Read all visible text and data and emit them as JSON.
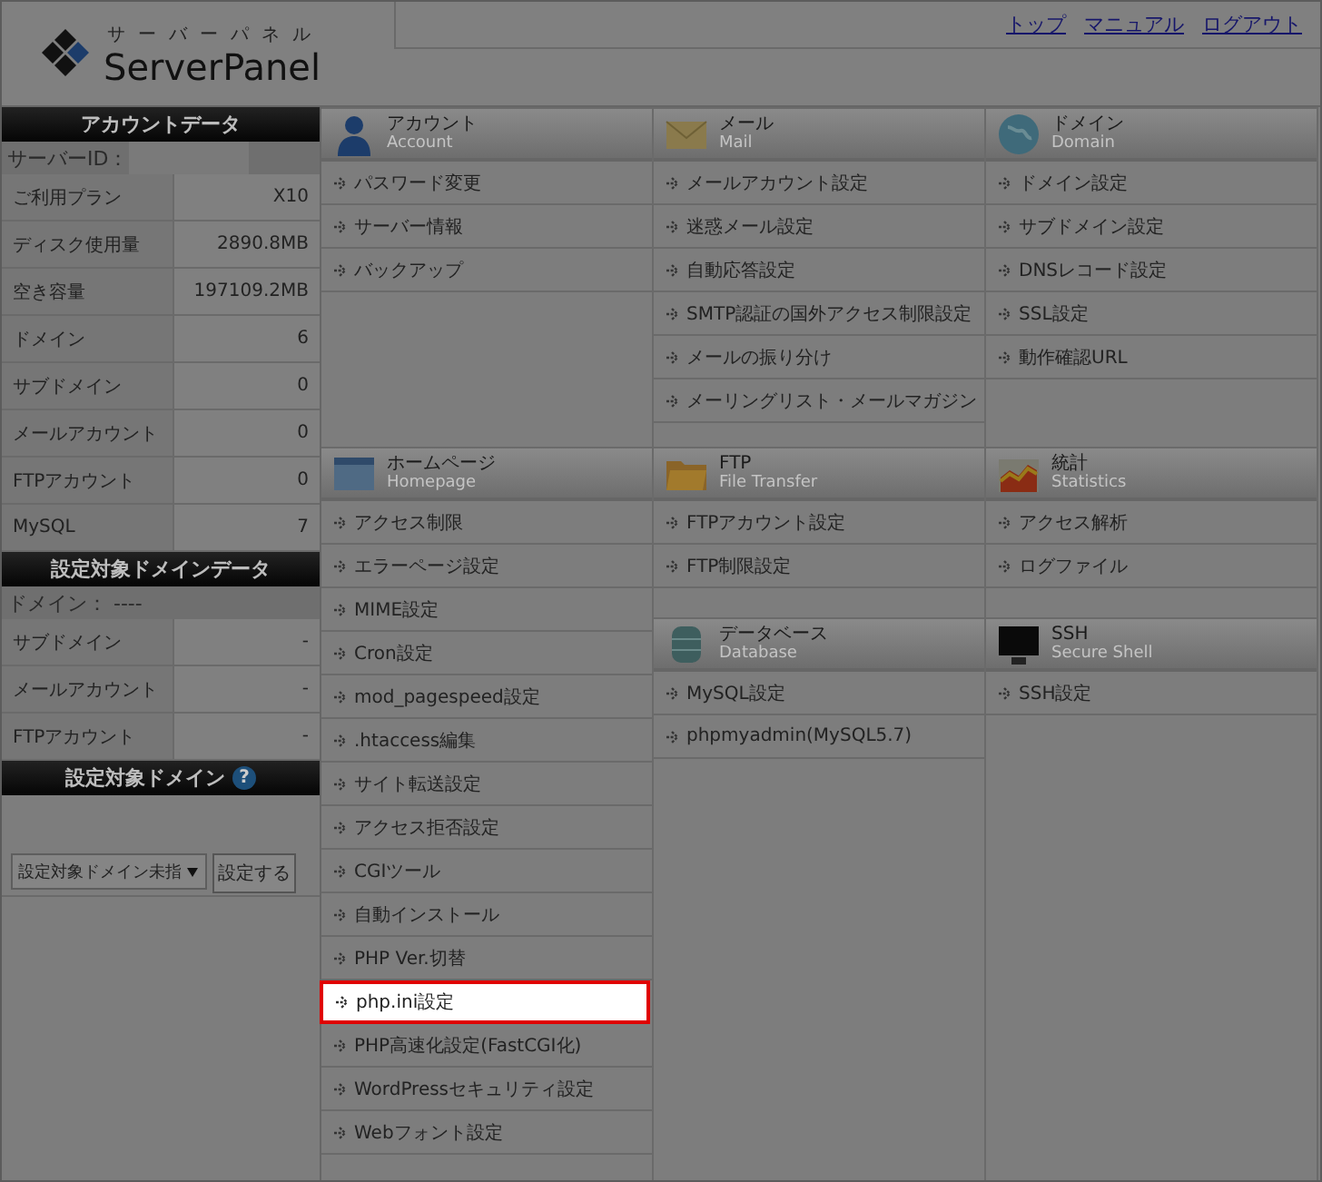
{
  "header": {
    "logo_kana": "サーバーパネル",
    "logo_text": "ServerPanel",
    "links": [
      "トップ",
      "マニュアル",
      "ログアウト"
    ]
  },
  "sidebar": {
    "account_title": "アカウントデータ",
    "server_id_label": "サーバーID：",
    "account_rows": [
      {
        "label": "ご利用プラン",
        "value": "X10"
      },
      {
        "label": "ディスク使用量",
        "value": "2890.8MB"
      },
      {
        "label": "空き容量",
        "value": "197109.2MB"
      },
      {
        "label": "ドメイン",
        "value": "6"
      },
      {
        "label": "サブドメイン",
        "value": "0"
      },
      {
        "label": "メールアカウント",
        "value": "0"
      },
      {
        "label": "FTPアカウント",
        "value": "0"
      },
      {
        "label": "MySQL",
        "value": "7"
      }
    ],
    "domain_data_title": "設定対象ドメインデータ",
    "domain_label": "ドメイン： ----",
    "domain_rows": [
      {
        "label": "サブドメイン",
        "value": "-"
      },
      {
        "label": "メールアカウント",
        "value": "-"
      },
      {
        "label": "FTPアカウント",
        "value": "-"
      }
    ],
    "domain_select_title": "設定対象ドメイン",
    "help_mark": "?",
    "select_value": "設定対象ドメイン未指",
    "set_button": "設定する"
  },
  "sections": [
    {
      "kind": "account",
      "title": "アカウント",
      "subtitle": "Account",
      "items": [
        {
          "label": "パスワード変更",
          "highlighted": false
        },
        {
          "label": "サーバー情報",
          "highlighted": false
        },
        {
          "label": "バックアップ",
          "highlighted": false
        }
      ]
    },
    {
      "kind": "mail",
      "title": "メール",
      "subtitle": "Mail",
      "items": [
        {
          "label": "メールアカウント設定",
          "highlighted": false
        },
        {
          "label": "迷惑メール設定",
          "highlighted": false
        },
        {
          "label": "自動応答設定",
          "highlighted": false
        },
        {
          "label": "SMTP認証の国外アクセス制限設定",
          "highlighted": false
        },
        {
          "label": "メールの振り分け",
          "highlighted": false
        },
        {
          "label": "メーリングリスト・メールマガジン",
          "highlighted": false
        }
      ]
    },
    {
      "kind": "domain",
      "title": "ドメイン",
      "subtitle": "Domain",
      "items": [
        {
          "label": "ドメイン設定",
          "highlighted": false
        },
        {
          "label": "サブドメイン設定",
          "highlighted": false
        },
        {
          "label": "DNSレコード設定",
          "highlighted": false
        },
        {
          "label": "SSL設定",
          "highlighted": false
        },
        {
          "label": "動作確認URL",
          "highlighted": false
        }
      ]
    },
    {
      "kind": "homepage",
      "title": "ホームページ",
      "subtitle": "Homepage",
      "items": [
        {
          "label": "アクセス制限",
          "highlighted": false
        },
        {
          "label": "エラーページ設定",
          "highlighted": false
        },
        {
          "label": "MIME設定",
          "highlighted": false
        },
        {
          "label": "Cron設定",
          "highlighted": false
        },
        {
          "label": "mod_pagespeed設定",
          "highlighted": false
        },
        {
          "label": ".htaccess編集",
          "highlighted": false
        },
        {
          "label": "サイト転送設定",
          "highlighted": false
        },
        {
          "label": "アクセス拒否設定",
          "highlighted": false
        },
        {
          "label": "CGIツール",
          "highlighted": false
        },
        {
          "label": "自動インストール",
          "highlighted": false
        },
        {
          "label": "PHP Ver.切替",
          "highlighted": false
        },
        {
          "label": "php.ini設定",
          "highlighted": true
        },
        {
          "label": "PHP高速化設定(FastCGI化)",
          "highlighted": false
        },
        {
          "label": "WordPressセキュリティ設定",
          "highlighted": false
        },
        {
          "label": "Webフォント設定",
          "highlighted": false
        }
      ]
    },
    {
      "kind": "ftp",
      "title": "FTP",
      "subtitle": "File Transfer",
      "items": [
        {
          "label": "FTPアカウント設定",
          "highlighted": false
        },
        {
          "label": "FTP制限設定",
          "highlighted": false
        }
      ]
    },
    {
      "kind": "statistics",
      "title": "統計",
      "subtitle": "Statistics",
      "items": [
        {
          "label": "アクセス解析",
          "highlighted": false
        },
        {
          "label": "ログファイル",
          "highlighted": false
        }
      ]
    },
    {
      "kind": "database",
      "title": "データベース",
      "subtitle": "Database",
      "items": [
        {
          "label": "MySQL設定",
          "highlighted": false
        },
        {
          "label": "phpmyadmin(MySQL5.7)",
          "highlighted": false
        }
      ]
    },
    {
      "kind": "ssh",
      "title": "SSH",
      "subtitle": "Secure Shell",
      "items": [
        {
          "label": "SSH設定",
          "highlighted": false
        }
      ]
    }
  ]
}
